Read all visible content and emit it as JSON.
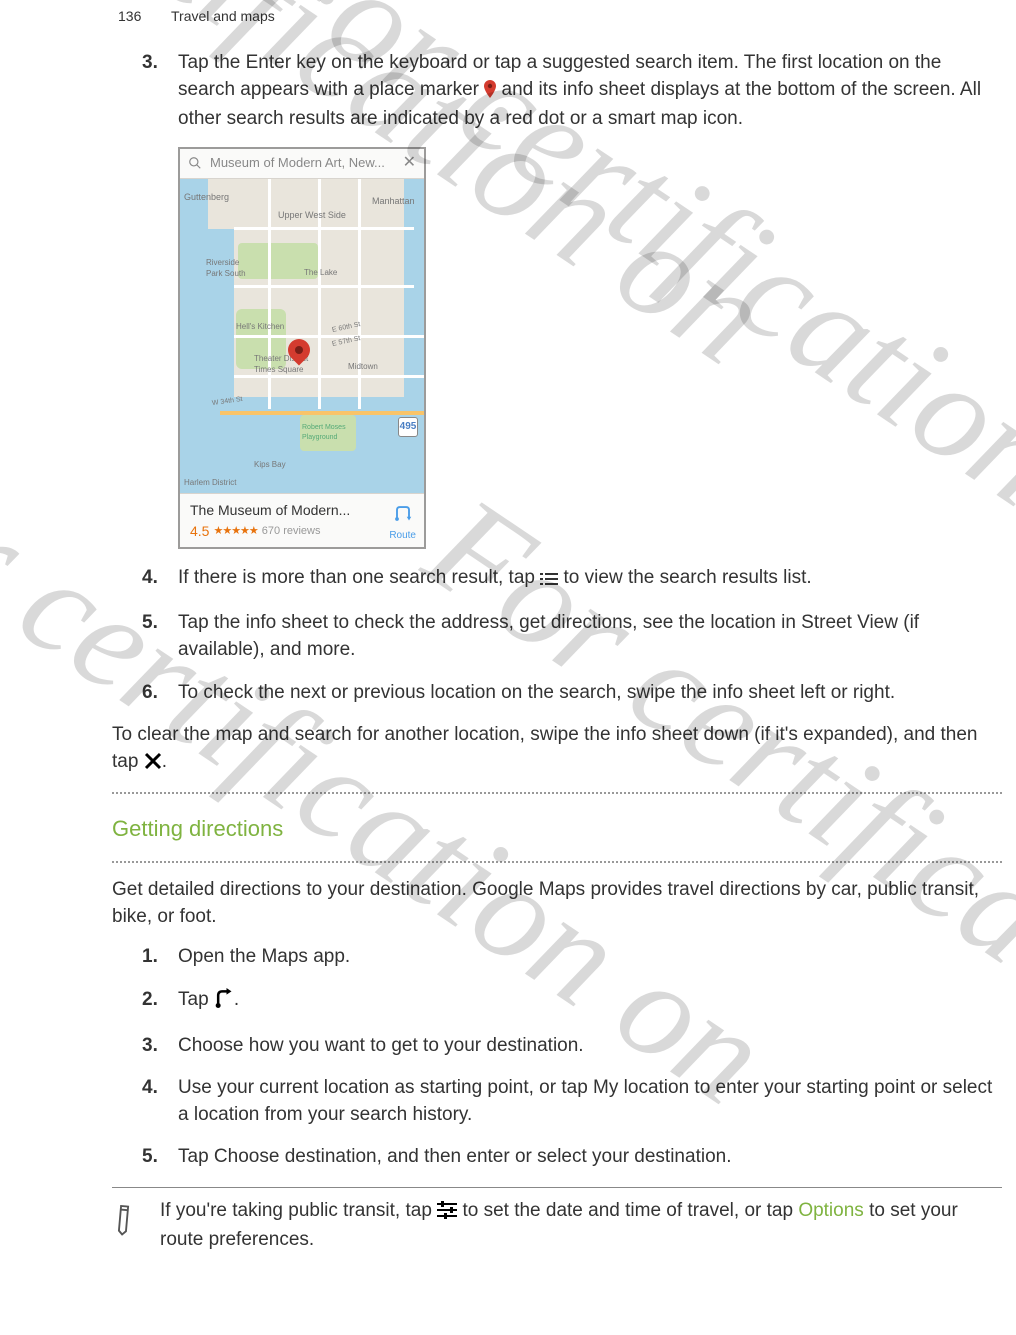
{
  "header": {
    "page_number": "136",
    "section": "Travel and maps"
  },
  "watermark": "For certification on",
  "steps_a": {
    "s3_a": "Tap the ",
    "s3_key": "Enter",
    "s3_b": " key on the keyboard or tap a suggested search item. The first location on the search appears with a place marker ",
    "s3_c": " and its info sheet displays at the bottom of the screen. All other search results are indicated by a red dot or a smart map icon.",
    "s4_a": "If there is more than one search result, tap ",
    "s4_b": " to view the search results list.",
    "s5": "Tap the info sheet to check the address, get directions, see the location in Street View (if available), and more.",
    "s6": "To check the next or previous location on the search, swipe the info sheet left or right."
  },
  "clear_a": "To clear the map and search for another location, swipe the info sheet down (if it's expanded), and then tap ",
  "clear_b": ".",
  "section2": "Getting directions",
  "section2_intro": "Get detailed directions to your destination. Google Maps provides travel directions by car, public transit, bike, or foot.",
  "steps_b": {
    "s1": "Open the Maps app.",
    "s2_a": "Tap ",
    "s2_b": ".",
    "s3": "Choose how you want to get to your destination.",
    "s4_a": "Use your current location as starting point, or tap ",
    "s4_key": "My location",
    "s4_b": " to enter your starting point or select a location from your search history.",
    "s5_a": "Tap ",
    "s5_key": "Choose destination",
    "s5_b": ", and then enter or select your destination."
  },
  "note_a": "If you're taking public transit, tap ",
  "note_b": " to set the date and time of travel, or tap ",
  "note_key": "Options",
  "note_c": " to set your route preferences.",
  "screenshot": {
    "search_placeholder": "Museum of Modern Art, New...",
    "info_title": "The Museum of Modern...",
    "rating": "4.5",
    "stars": "★★★★★",
    "reviews": "670 reviews",
    "route_label": "Route",
    "map_labels": {
      "guttenberg": "Guttenberg",
      "uws": "Upper West Side",
      "manhattan": "Manhattan",
      "riverside": "Riverside Park South",
      "thelake": "The Lake",
      "hells": "Hell's Kitchen",
      "theater": "Theater District Times Square",
      "midtown": "Midtown",
      "e60": "E 60th St",
      "e57": "E 57th St",
      "w34": "W 34th St",
      "robert": "Robert Moses Playground",
      "kips": "Kips Bay",
      "hudson": "Harlem District"
    }
  }
}
